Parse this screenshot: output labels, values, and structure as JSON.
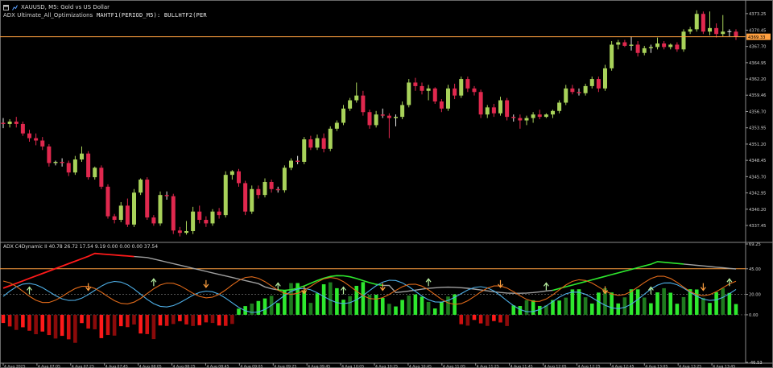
{
  "titlebar": {
    "icon_1": "window-icon",
    "icon_2": "chart-icon",
    "title": "XAUUSD, M5:  Gold vs US Dollar"
  },
  "main_chart": {
    "indicator_label": "ADX Ultimate_All_Optimizations",
    "expression": "MAHTF1(PERIOD_M5): BULLHTF2(PER",
    "current_price": "4369.33",
    "price_line_color": "#ffa040",
    "bull_color": "#a8d25a",
    "bear_color": "#e0284e",
    "y_labels": [
      "4373.25",
      "4370.45",
      "4367.70",
      "4364.95",
      "4362.20",
      "4359.46",
      "4356.70",
      "4353.95",
      "4351.20",
      "4348.45",
      "4345.70",
      "4342.95",
      "4340.20",
      "4337.45"
    ],
    "candles": [
      [
        4354.8,
        4355.6,
        4353.9,
        4354.6
      ],
      [
        4354.6,
        4355.4,
        4354.0,
        4355.0
      ],
      [
        4355.0,
        4355.8,
        4354.0,
        4354.6
      ],
      [
        4354.6,
        4355.0,
        4352.6,
        4353.0
      ],
      [
        4353.0,
        4353.6,
        4351.6,
        4352.2
      ],
      [
        4352.2,
        4353.0,
        4351.0,
        4351.8
      ],
      [
        4351.8,
        4352.4,
        4350.2,
        4350.8
      ],
      [
        4350.8,
        4351.2,
        4347.4,
        4348.0
      ],
      [
        4348.0,
        4348.4,
        4347.6,
        4348.2
      ],
      [
        4348.2,
        4348.8,
        4347.4,
        4348.0
      ],
      [
        4348.0,
        4348.4,
        4345.8,
        4346.4
      ],
      [
        4346.4,
        4349.2,
        4346.0,
        4348.6
      ],
      [
        4348.6,
        4350.8,
        4348.2,
        4349.6
      ],
      [
        4349.6,
        4350.0,
        4345.2,
        4345.6
      ],
      [
        4345.6,
        4347.4,
        4345.2,
        4347.2
      ],
      [
        4347.2,
        4347.6,
        4343.6,
        4344.0
      ],
      [
        4344.0,
        4344.4,
        4338.6,
        4339.0
      ],
      [
        4339.0,
        4339.4,
        4337.8,
        4338.4
      ],
      [
        4338.4,
        4341.4,
        4338.0,
        4340.8
      ],
      [
        4340.8,
        4342.0,
        4337.2,
        4337.6
      ],
      [
        4337.6,
        4343.6,
        4337.2,
        4343.0
      ],
      [
        4343.0,
        4345.4,
        4342.6,
        4345.2
      ],
      [
        4345.2,
        4345.6,
        4338.4,
        4338.8
      ],
      [
        4338.8,
        4339.2,
        4337.4,
        4337.8
      ],
      [
        4337.8,
        4343.2,
        4337.4,
        4342.6
      ],
      [
        4342.6,
        4343.2,
        4341.8,
        4342.4
      ],
      [
        4342.4,
        4342.8,
        4336.0,
        4336.6
      ],
      [
        4336.6,
        4337.2,
        4335.6,
        4336.2
      ],
      [
        4336.2,
        4338.2,
        4335.9,
        4336.5
      ],
      [
        4336.5,
        4340.6,
        4336.0,
        4339.8
      ],
      [
        4339.8,
        4340.8,
        4337.8,
        4338.4
      ],
      [
        4338.4,
        4339.0,
        4337.2,
        4337.8
      ],
      [
        4337.8,
        4340.2,
        4337.4,
        4339.8
      ],
      [
        4339.8,
        4340.4,
        4338.6,
        4339.2
      ],
      [
        4339.2,
        4346.6,
        4338.8,
        4346.0
      ],
      [
        4346.0,
        4346.8,
        4345.2,
        4346.6
      ],
      [
        4346.6,
        4347.0,
        4344.0,
        4344.6
      ],
      [
        4344.6,
        4345.0,
        4339.2,
        4339.8
      ],
      [
        4339.8,
        4344.2,
        4339.4,
        4343.6
      ],
      [
        4343.6,
        4344.2,
        4342.0,
        4342.6
      ],
      [
        4342.6,
        4345.4,
        4342.2,
        4344.8
      ],
      [
        4344.8,
        4345.2,
        4343.0,
        4343.6
      ],
      [
        4343.6,
        4344.0,
        4343.0,
        4343.4
      ],
      [
        4343.4,
        4347.6,
        4343.0,
        4347.2
      ],
      [
        4347.2,
        4348.8,
        4346.8,
        4348.4
      ],
      [
        4348.4,
        4349.2,
        4347.8,
        4348.2
      ],
      [
        4348.2,
        4352.4,
        4347.8,
        4352.0
      ],
      [
        4352.0,
        4352.6,
        4350.2,
        4350.6
      ],
      [
        4350.6,
        4352.8,
        4350.2,
        4352.2
      ],
      [
        4352.2,
        4353.0,
        4349.8,
        4350.4
      ],
      [
        4350.4,
        4354.2,
        4350.0,
        4353.8
      ],
      [
        4353.8,
        4355.2,
        4353.4,
        4354.8
      ],
      [
        4354.8,
        4357.8,
        4354.4,
        4357.2
      ],
      [
        4357.2,
        4359.0,
        4356.8,
        4358.6
      ],
      [
        4358.6,
        4361.6,
        4358.2,
        4359.4
      ],
      [
        4359.4,
        4360.2,
        4356.0,
        4356.6
      ],
      [
        4356.6,
        4357.0,
        4353.8,
        4354.4
      ],
      [
        4354.4,
        4356.8,
        4354.0,
        4356.2
      ],
      [
        4356.2,
        4357.2,
        4355.6,
        4356.0
      ],
      [
        4356.0,
        4356.4,
        4352.2,
        4355.6
      ],
      [
        4355.6,
        4356.2,
        4354.2,
        4355.8
      ],
      [
        4355.8,
        4358.4,
        4355.4,
        4357.8
      ],
      [
        4357.8,
        4362.2,
        4357.4,
        4361.6
      ],
      [
        4361.6,
        4362.4,
        4360.2,
        4361.0
      ],
      [
        4361.0,
        4361.6,
        4359.6,
        4360.2
      ],
      [
        4360.2,
        4361.2,
        4358.6,
        4360.6
      ],
      [
        4360.6,
        4360.8,
        4358.0,
        4358.4
      ],
      [
        4358.4,
        4358.8,
        4356.6,
        4357.2
      ],
      [
        4357.2,
        4361.2,
        4356.8,
        4360.6
      ],
      [
        4360.6,
        4361.4,
        4358.8,
        4359.4
      ],
      [
        4359.4,
        4362.6,
        4359.0,
        4362.2
      ],
      [
        4362.2,
        4362.6,
        4360.0,
        4360.6
      ],
      [
        4360.6,
        4361.0,
        4359.4,
        4360.0
      ],
      [
        4360.0,
        4360.4,
        4355.6,
        4356.2
      ],
      [
        4356.2,
        4357.8,
        4355.6,
        4357.4
      ],
      [
        4357.4,
        4358.0,
        4355.8,
        4356.4
      ],
      [
        4356.4,
        4359.2,
        4356.0,
        4358.6
      ],
      [
        4358.6,
        4359.0,
        4355.2,
        4355.8
      ],
      [
        4355.8,
        4356.2,
        4355.0,
        4355.6
      ],
      [
        4355.6,
        4356.2,
        4353.8,
        4355.2
      ],
      [
        4355.2,
        4356.0,
        4354.4,
        4355.6
      ],
      [
        4355.6,
        4356.6,
        4354.8,
        4356.2
      ],
      [
        4356.2,
        4357.0,
        4355.4,
        4355.8
      ],
      [
        4355.8,
        4356.4,
        4355.6,
        4356.2
      ],
      [
        4356.2,
        4357.0,
        4355.6,
        4356.8
      ],
      [
        4356.8,
        4358.6,
        4356.4,
        4358.2
      ],
      [
        4358.2,
        4361.2,
        4357.8,
        4360.6
      ],
      [
        4360.6,
        4361.2,
        4359.6,
        4360.0
      ],
      [
        4360.0,
        4360.6,
        4359.4,
        4359.8
      ],
      [
        4359.8,
        4361.4,
        4359.4,
        4361.0
      ],
      [
        4361.0,
        4362.6,
        4360.6,
        4362.2
      ],
      [
        4362.2,
        4362.6,
        4360.0,
        4360.6
      ],
      [
        4360.6,
        4364.6,
        4360.2,
        4364.0
      ],
      [
        4364.0,
        4368.6,
        4363.6,
        4368.0
      ],
      [
        4368.0,
        4368.8,
        4367.2,
        4368.4
      ],
      [
        4368.4,
        4368.8,
        4367.6,
        4367.8
      ],
      [
        4367.8,
        4369.4,
        4367.0,
        4368.0
      ],
      [
        4368.0,
        4368.6,
        4366.0,
        4366.6
      ],
      [
        4366.6,
        4367.8,
        4366.2,
        4367.4
      ],
      [
        4367.4,
        4368.0,
        4366.6,
        4367.6
      ],
      [
        4367.6,
        4369.2,
        4367.2,
        4368.2
      ],
      [
        4368.2,
        4368.6,
        4367.2,
        4367.6
      ],
      [
        4367.6,
        4368.2,
        4367.2,
        4368.0
      ],
      [
        4368.0,
        4368.4,
        4366.8,
        4367.2
      ],
      [
        4367.2,
        4370.6,
        4366.8,
        4370.2
      ],
      [
        4370.2,
        4371.0,
        4369.8,
        4370.6
      ],
      [
        4370.6,
        4373.8,
        4370.2,
        4373.2
      ],
      [
        4373.2,
        4373.6,
        4369.8,
        4370.2
      ],
      [
        4370.2,
        4373.6,
        4369.6,
        4370.8
      ],
      [
        4370.8,
        4371.6,
        4369.2,
        4369.8
      ],
      [
        4369.8,
        4373.0,
        4369.4,
        4370.2
      ],
      [
        4370.2,
        4370.6,
        4369.4,
        4370.2
      ],
      [
        4370.2,
        4370.6,
        4368.8,
        4369.4
      ]
    ]
  },
  "sub_chart": {
    "title": "ADX C4Dynamic II 40.78 26.72 17.54 9.19 0.00 0.00 0.00 37.54",
    "y_labels": [
      "69.25",
      "45.00",
      "20.00",
      "0.00",
      "-46.53"
    ],
    "levels_labels": [
      "45.00",
      "20.00"
    ]
  },
  "time_axis": {
    "labels": [
      "4 Aug 2025",
      "4 Aug 07:05",
      "4 Aug 07:25",
      "4 Aug 07:45",
      "4 Aug 08:05",
      "4 Aug 08:25",
      "4 Aug 08:45",
      "4 Aug 09:05",
      "4 Aug 09:25",
      "4 Aug 09:45",
      "4 Aug 10:05",
      "4 Aug 10:25",
      "4 Aug 10:45",
      "4 Aug 11:05",
      "4 Aug 11:25",
      "4 Aug 11:45",
      "4 Aug 12:05",
      "4 Aug 12:25",
      "4 Aug 12:45",
      "4 Aug 13:05",
      "4 Aug 13:25",
      "4 Aug 13:45"
    ]
  }
}
